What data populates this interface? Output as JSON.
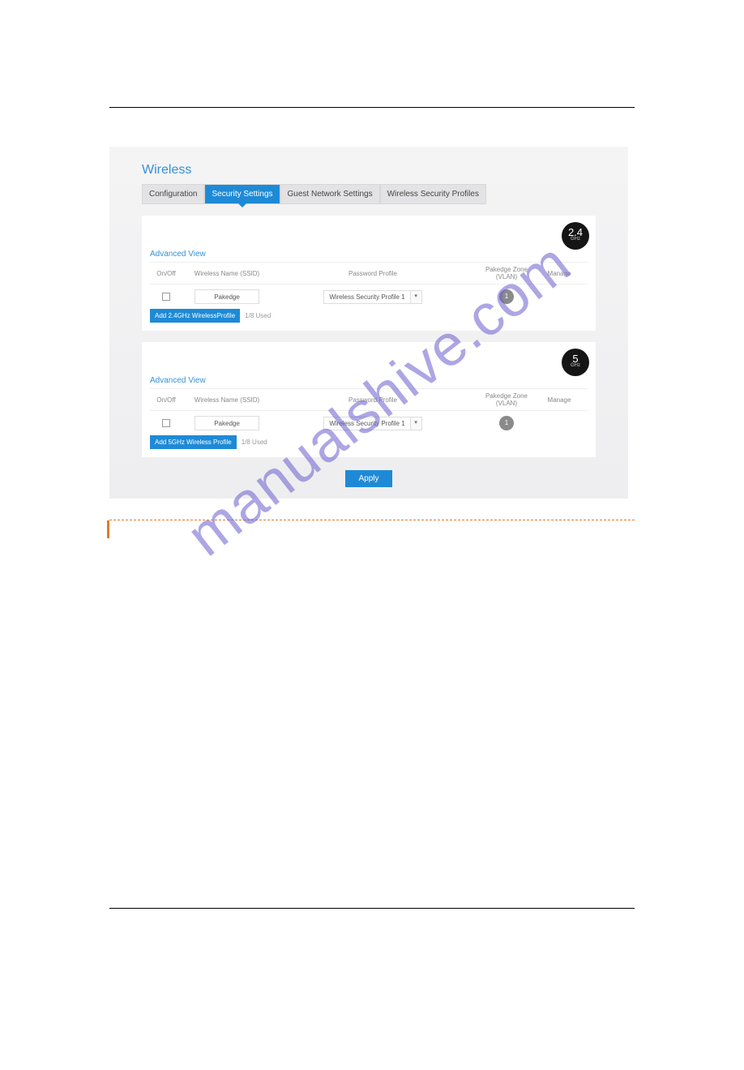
{
  "watermark_text": "manualshive.com",
  "screenshot": {
    "title": "Wireless",
    "tabs": [
      {
        "label": "Configuration",
        "active": false
      },
      {
        "label": "Security Settings",
        "active": true
      },
      {
        "label": "Guest Network Settings",
        "active": false
      },
      {
        "label": "Wireless Security Profiles",
        "active": false
      }
    ],
    "columns": {
      "onoff": "On/Off",
      "ssid": "Wireless Name (SSID)",
      "profile": "Password Profile",
      "vlan": "Pakedge Zone (VLAN)",
      "manage": "Manage"
    },
    "bands": [
      {
        "badge_big": "2.4",
        "badge_sub": "GHz",
        "advanced_label": "Advanced View",
        "row": {
          "ssid_value": "Pakedge",
          "profile_value": "Wireless Security Profile 1",
          "vlan_value": "1"
        },
        "add_button": "Add 2.4GHz WirelessProfile",
        "used_text": "1/8 Used"
      },
      {
        "badge_big": "5",
        "badge_sub": "GHz",
        "advanced_label": "Advanced View",
        "row": {
          "ssid_value": "Pakedge",
          "profile_value": "Wireless Security Profile 1",
          "vlan_value": "1"
        },
        "add_button": "Add 5GHz Wireless Profile",
        "used_text": "1/8 Used"
      }
    ],
    "apply_label": "Apply"
  }
}
